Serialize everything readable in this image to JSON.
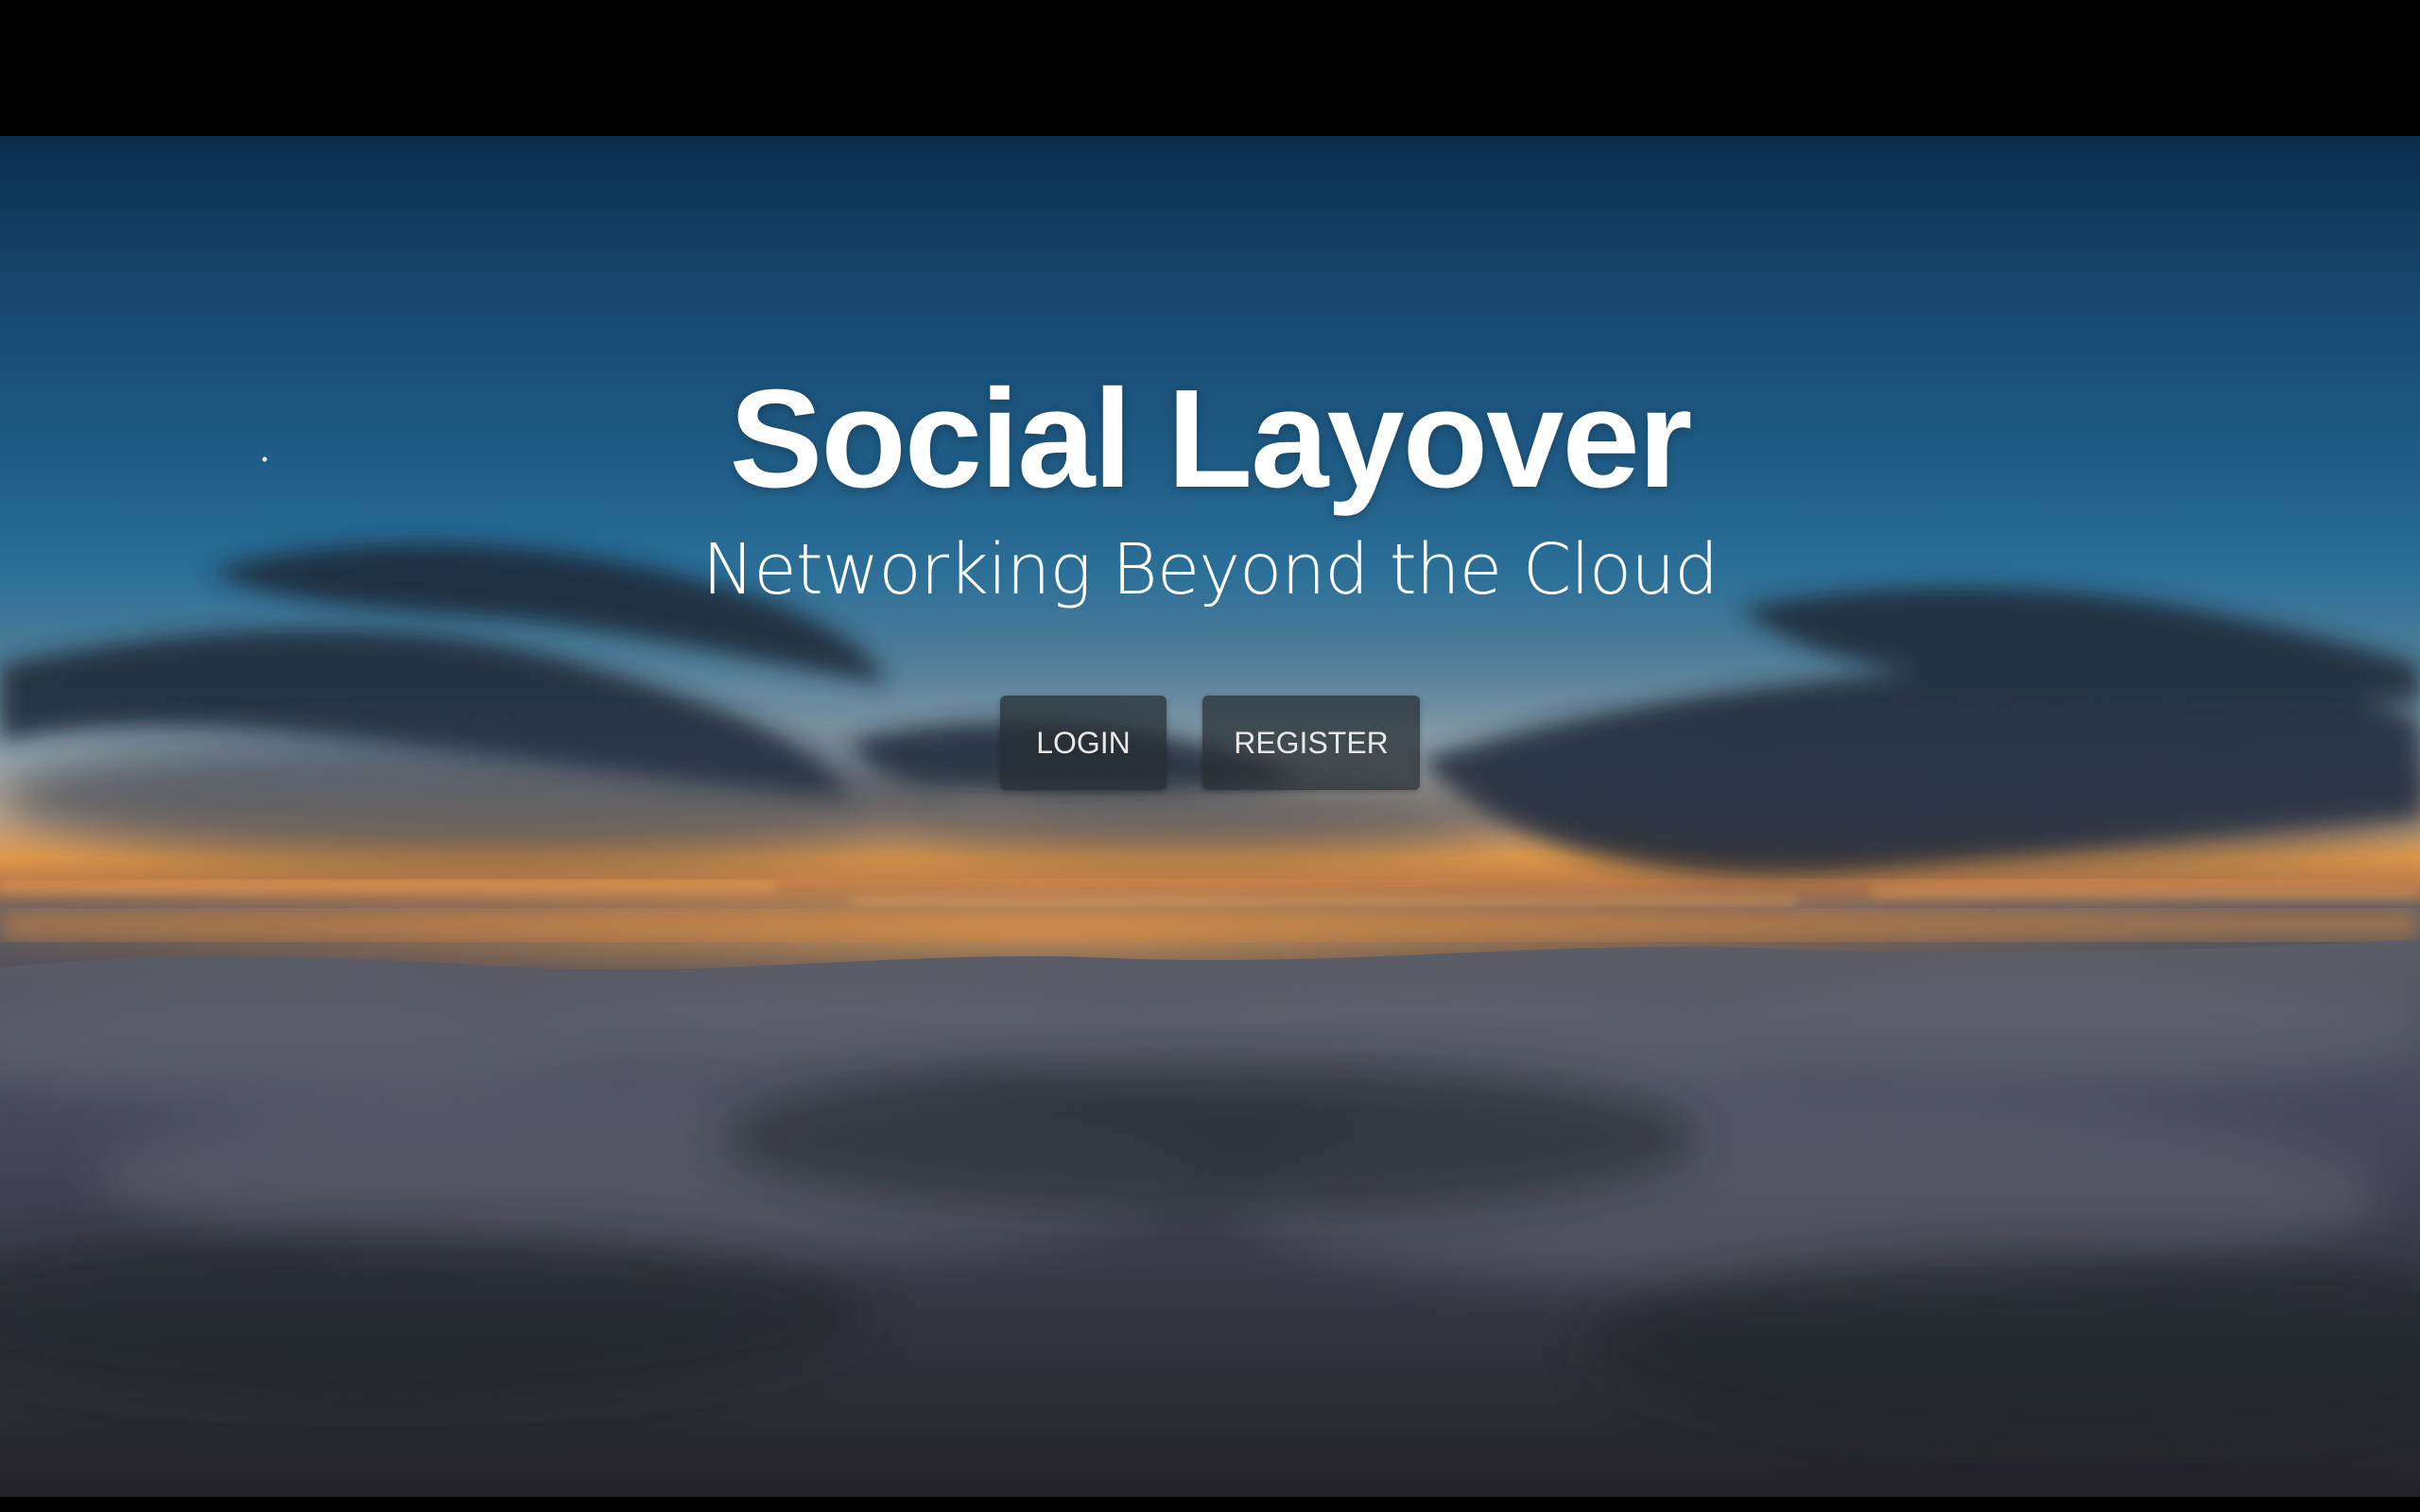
{
  "hero": {
    "title": "Social Layover",
    "subtitle": "Networking Beyond the Cloud",
    "background_description_icon": "sunset-clouds-icon"
  },
  "actions": {
    "login_label": "LOGIN",
    "register_label": "REGISTER"
  },
  "colors": {
    "sky_top": "#0d2d4d",
    "sky_mid": "#2b6f98",
    "horizon": "#e29a4a",
    "clouds": "#3d3f48",
    "button_bg": "#262c32",
    "text": "#ffffff"
  }
}
